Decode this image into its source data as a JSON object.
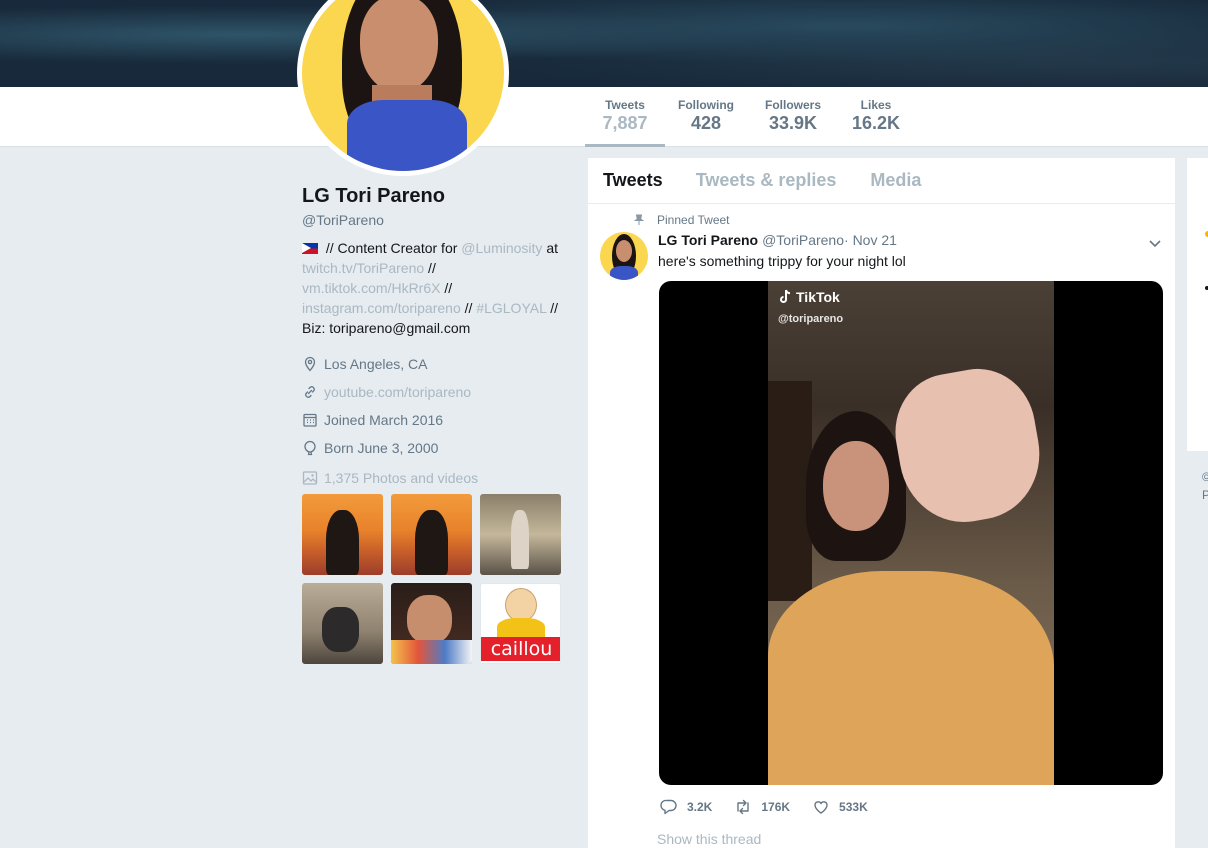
{
  "profile": {
    "name": "LG Tori Pareno",
    "handle": "@ToriPareno",
    "bio": {
      "flag_icon": "philippines-flag-icon",
      "p1": " // Content Creator for ",
      "mention": "@Luminosity",
      "p2": " at ",
      "link1": "twitch.tv/ToriPareno",
      "sep1": " // ",
      "link2": "vm.tiktok.com/HkRr6X",
      "sep2": " // ",
      "link3": "instagram.com/toripareno",
      "sep3": " // ",
      "hashtag": "#LGLOYAL",
      "sep4": " //",
      "biz": "Biz: toripareno@gmail.com"
    },
    "location": "Los Angeles, CA",
    "website": "youtube.com/toripareno",
    "joined": "Joined March 2016",
    "born": "Born June 3, 2000",
    "photos_label": "1,375 Photos and videos",
    "thumb_caillou_text": "caillou"
  },
  "stats": [
    {
      "label": "Tweets",
      "value": "7,887"
    },
    {
      "label": "Following",
      "value": "428"
    },
    {
      "label": "Followers",
      "value": "33.9K"
    },
    {
      "label": "Likes",
      "value": "16.2K"
    }
  ],
  "tabs": [
    "Tweets",
    "Tweets & replies",
    "Media"
  ],
  "tweet": {
    "pinned_label": "Pinned Tweet",
    "author": "LG Tori Pareno",
    "handle": "@ToriPareno",
    "date": " · Nov 21",
    "text": "here's something trippy for your night lol",
    "tiktok_label": "TikTok",
    "tiktok_user": "@toripareno",
    "replies": "3.2K",
    "retweets": "176K",
    "likes": "533K",
    "show_thread": "Show this thread"
  },
  "right_edge": {
    "line1": "©",
    "line2": "P"
  },
  "colors": {
    "accent_link": "#aab8c2",
    "avatar_bg": "#fbd64f",
    "banner": "#17293a"
  }
}
